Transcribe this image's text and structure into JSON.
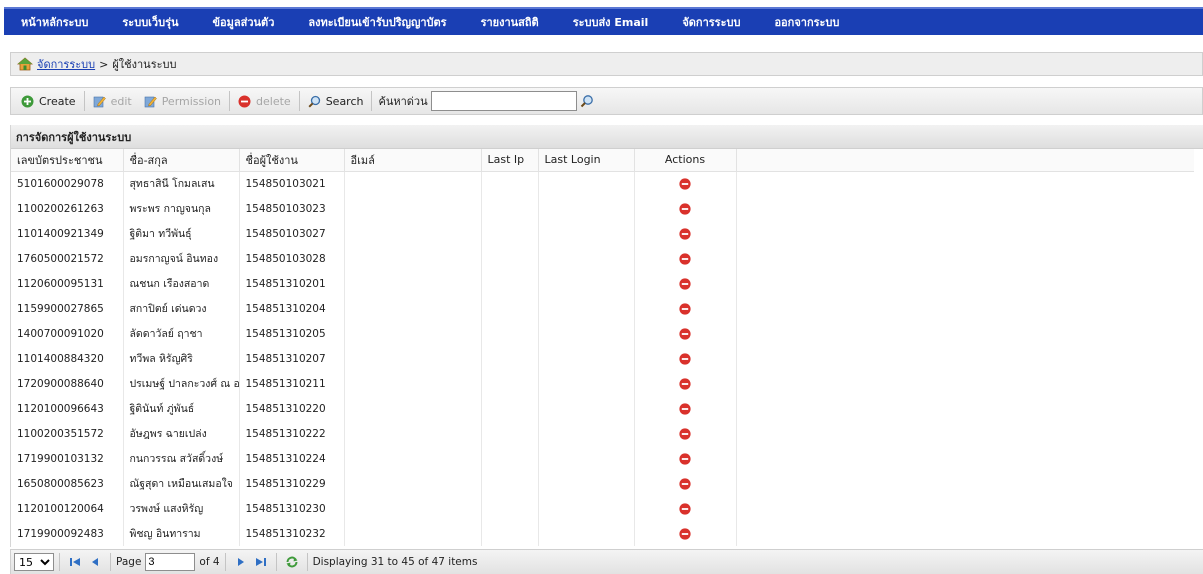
{
  "nav": {
    "items": [
      {
        "label": "หน้าหลักระบบ"
      },
      {
        "label": "ระบบเว็บรุ่น"
      },
      {
        "label": "ข้อมูลส่วนตัว"
      },
      {
        "label": "ลงทะเบียนเข้ารับปริญญาบัตร"
      },
      {
        "label": "รายงานสถิติ"
      },
      {
        "label": "ระบบส่ง Email"
      },
      {
        "label": "จัดการระบบ"
      },
      {
        "label": "ออกจากระบบ"
      }
    ]
  },
  "breadcrumb": {
    "link": "จัดการระบบ",
    "separator": ">",
    "current": "ผู้ใช้งานระบบ"
  },
  "toolbar": {
    "create_label": "Create",
    "edit_label": "edit",
    "permission_label": "Permission",
    "delete_label": "delete",
    "search_label": "Search",
    "quick_search_label": "ค้นหาด่วน",
    "quick_search_value": ""
  },
  "grid": {
    "title": "การจัดการผู้ใช้งานระบบ",
    "columns": [
      "เลขบัตรประชาชน",
      "ชื่อ-สกุล",
      "ชื่อผู้ใช้งาน",
      "อีเมล์",
      "Last Ip",
      "Last Login",
      "Actions"
    ],
    "rows": [
      {
        "citizen_id": "5101600029078",
        "name": "สุทธาสินี โกมลเสน",
        "username": "154850103021",
        "email": "",
        "last_ip": "",
        "last_login": ""
      },
      {
        "citizen_id": "1100200261263",
        "name": "พระพร กาญจนกุล",
        "username": "154850103023",
        "email": "",
        "last_ip": "",
        "last_login": ""
      },
      {
        "citizen_id": "1101400921349",
        "name": "ฐิติมา ทวีพันธุ์",
        "username": "154850103027",
        "email": "",
        "last_ip": "",
        "last_login": ""
      },
      {
        "citizen_id": "1760500021572",
        "name": "อมรกาญจน์ อินทอง",
        "username": "154850103028",
        "email": "",
        "last_ip": "",
        "last_login": ""
      },
      {
        "citizen_id": "1120600095131",
        "name": "ณชนก เรืองสอาด",
        "username": "154851310201",
        "email": "",
        "last_ip": "",
        "last_login": ""
      },
      {
        "citizen_id": "1159900027865",
        "name": "สกาปิตย์ เด่นดวง",
        "username": "154851310204",
        "email": "",
        "last_ip": "",
        "last_login": ""
      },
      {
        "citizen_id": "1400700091020",
        "name": "ลัดดาวัลย์ ฤาชา",
        "username": "154851310205",
        "email": "",
        "last_ip": "",
        "last_login": ""
      },
      {
        "citizen_id": "1101400884320",
        "name": "ทวีพล หิรัญศิริ",
        "username": "154851310207",
        "email": "",
        "last_ip": "",
        "last_login": ""
      },
      {
        "citizen_id": "1720900088640",
        "name": "ปรเมษฐ์ ปาลกะวงศ์ ณ อยุธยา",
        "username": "154851310211",
        "email": "",
        "last_ip": "",
        "last_login": ""
      },
      {
        "citizen_id": "1120100096643",
        "name": "ฐิตินันท์ ภู่พันธ์",
        "username": "154851310220",
        "email": "",
        "last_ip": "",
        "last_login": ""
      },
      {
        "citizen_id": "1100200351572",
        "name": "อัษฎพร ฉายเปล่ง",
        "username": "154851310222",
        "email": "",
        "last_ip": "",
        "last_login": ""
      },
      {
        "citizen_id": "1719900103132",
        "name": "กนกวรรณ สวัสดิ์วงษ์",
        "username": "154851310224",
        "email": "",
        "last_ip": "",
        "last_login": ""
      },
      {
        "citizen_id": "1650800085623",
        "name": "ณัฐสุดา เหมือนเสมอใจ",
        "username": "154851310229",
        "email": "",
        "last_ip": "",
        "last_login": ""
      },
      {
        "citizen_id": "1120100120064",
        "name": "วรพงษ์ แสงหิรัญ",
        "username": "154851310230",
        "email": "",
        "last_ip": "",
        "last_login": ""
      },
      {
        "citizen_id": "1719900092483",
        "name": "พิชญ อินทาราม",
        "username": "154851310232",
        "email": "",
        "last_ip": "",
        "last_login": ""
      }
    ]
  },
  "pager": {
    "page_size": "15",
    "page_label": "Page",
    "current_page": "3",
    "of_label": "of 4",
    "status": "Displaying 31 to 45 of 47 items"
  },
  "colors": {
    "nav_bg": "#1a3fb4",
    "link": "#1a3fb4",
    "delete_red": "#d9312b"
  },
  "icons": {
    "home": "home-icon",
    "create": "add-circle-icon",
    "edit": "pencil-icon",
    "permission": "pencil-icon",
    "delete": "delete-circle-icon",
    "search": "magnifier-icon",
    "row_delete": "delete-circle-icon",
    "first": "first-page-icon",
    "prev": "prev-page-icon",
    "next": "next-page-icon",
    "last": "last-page-icon",
    "refresh": "refresh-icon"
  }
}
